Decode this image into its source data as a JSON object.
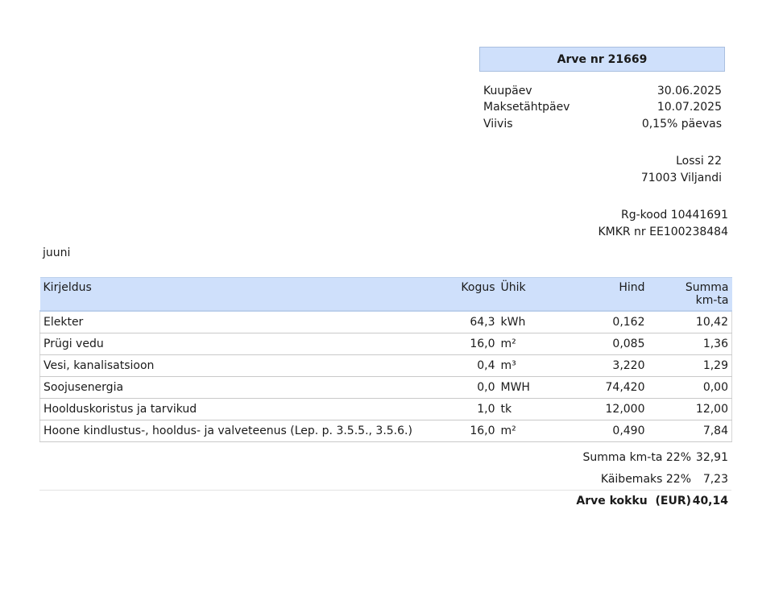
{
  "invoice": {
    "title": "Arve nr 21669",
    "meta": [
      {
        "label": "Kuupäev",
        "value": "30.06.2025"
      },
      {
        "label": "Maksetähtpäev",
        "value": "10.07.2025"
      },
      {
        "label": "Viivis",
        "value": "0,15% päevas"
      }
    ],
    "address": {
      "street": "Lossi 22",
      "city": "71003 Viljandi"
    },
    "registry": {
      "rg_code": "Rg-kood 10441691",
      "kmkr": "KMKR nr EE100238484"
    },
    "period": "juuni"
  },
  "table": {
    "headers": {
      "description": "Kirjeldus",
      "quantity": "Kogus",
      "unit": "Ühik",
      "price": "Hind",
      "sum_line1": "Summa",
      "sum_line2": "km-ta"
    },
    "rows": [
      {
        "description": "Elekter",
        "quantity": "64,3",
        "unit": "kWh",
        "price": "0,162",
        "sum": "10,42"
      },
      {
        "description": "Prügi vedu",
        "quantity": "16,0",
        "unit": "m²",
        "price": "0,085",
        "sum": "1,36"
      },
      {
        "description": "Vesi, kanalisatsioon",
        "quantity": "0,4",
        "unit": "m³",
        "price": "3,220",
        "sum": "1,29"
      },
      {
        "description": "Soojusenergia",
        "quantity": "0,0",
        "unit": "MWH",
        "price": "74,420",
        "sum": "0,00"
      },
      {
        "description": "Hoolduskoristus ja tarvikud",
        "quantity": "1,0",
        "unit": "tk",
        "price": "12,000",
        "sum": "12,00"
      },
      {
        "description": "Hoone kindlustus-, hooldus- ja valveteenus (Lep. p. 3.5.5., 3.5.6.)",
        "quantity": "16,0",
        "unit": "m²",
        "price": "0,490",
        "sum": "7,84"
      }
    ]
  },
  "totals": {
    "subtotal_label": "Summa km-ta 22%",
    "subtotal_value": "32,91",
    "vat_label": "Käibemaks 22%",
    "vat_value": "7,23",
    "grand_label": "Arve kokku  (EUR)",
    "grand_value": "40,14"
  }
}
